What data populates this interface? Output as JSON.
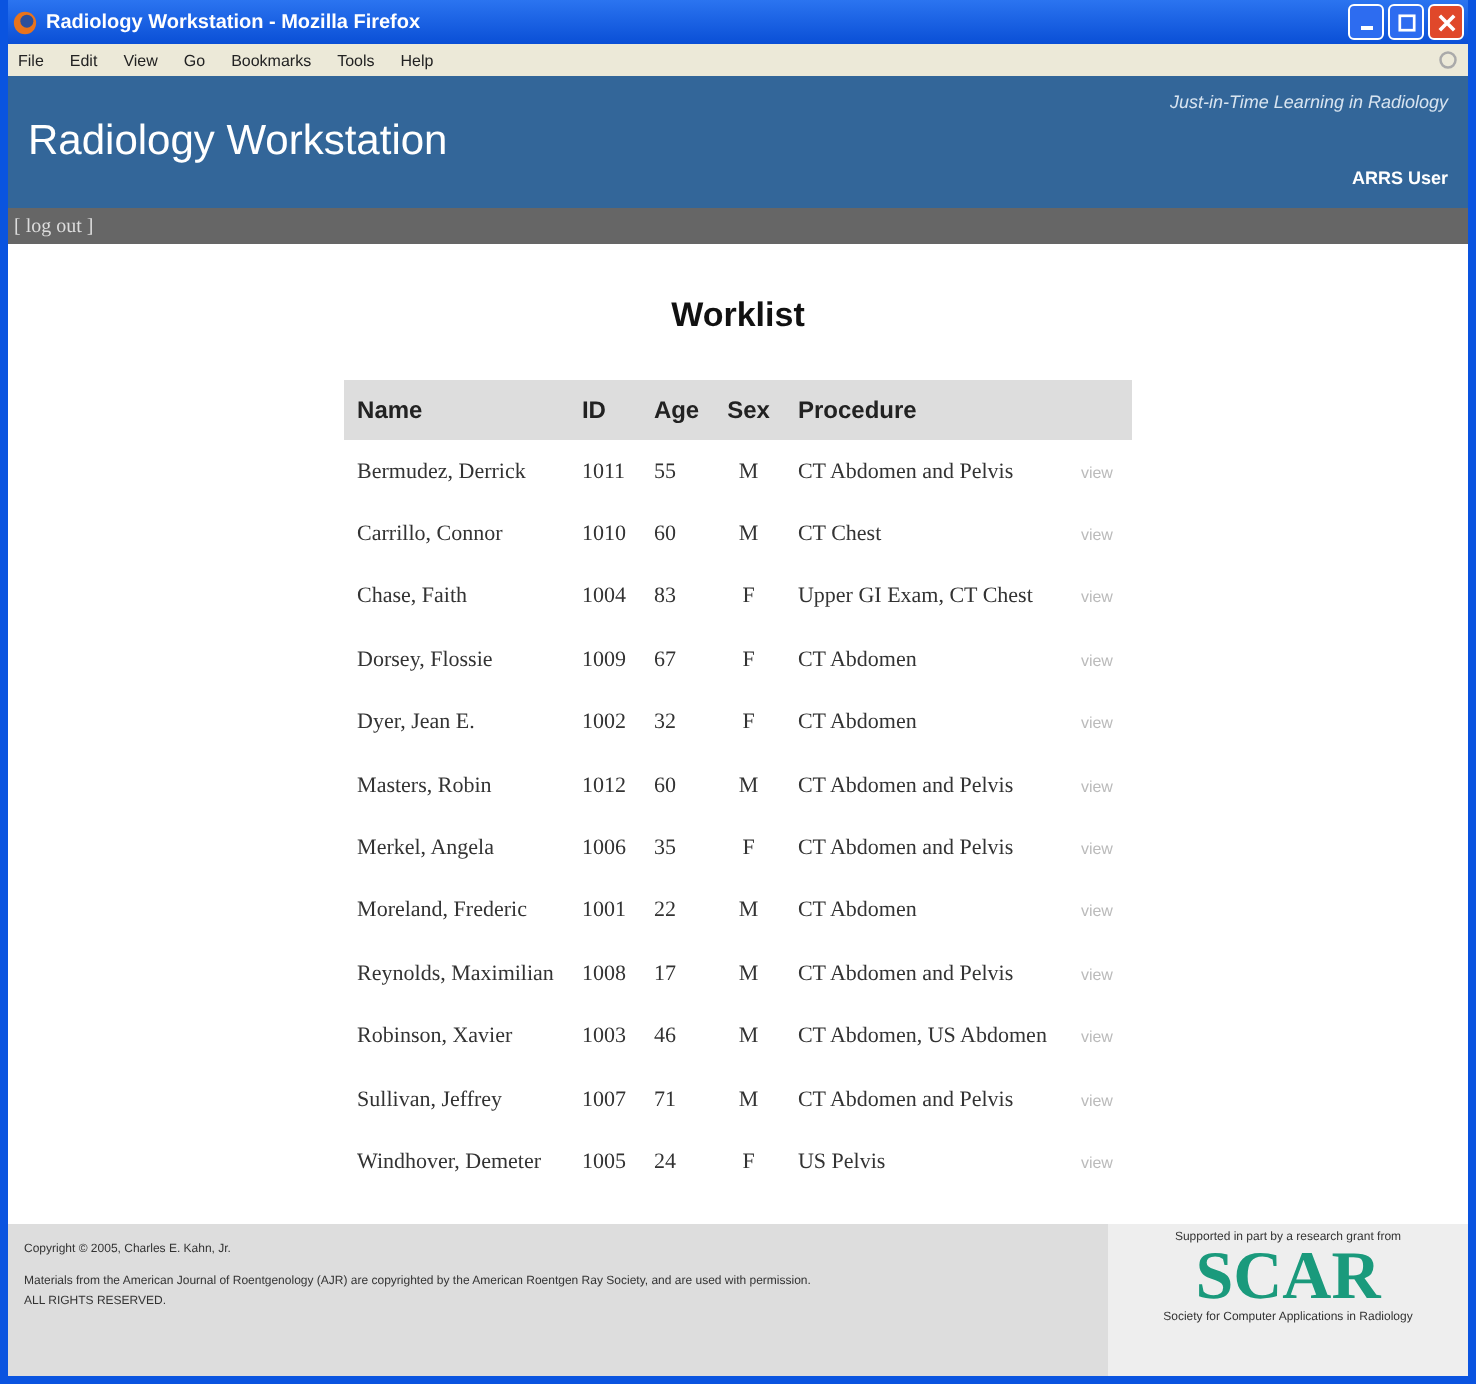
{
  "window": {
    "title": "Radiology Workstation - Mozilla Firefox"
  },
  "menu": [
    "File",
    "Edit",
    "View",
    "Go",
    "Bookmarks",
    "Tools",
    "Help"
  ],
  "header": {
    "title": "Radiology Workstation",
    "tagline": "Just-in-Time Learning in Radiology",
    "user": "ARRS User",
    "logout": "[ log out ]"
  },
  "worklist": {
    "title": "Worklist",
    "columns": [
      "Name",
      "ID",
      "Age",
      "Sex",
      "Procedure"
    ],
    "rows": [
      {
        "name": "Bermudez, Derrick",
        "id": "1011",
        "age": "55",
        "sex": "M",
        "procedure": "CT Abdomen and Pelvis",
        "action": "view"
      },
      {
        "name": "Carrillo, Connor",
        "id": "1010",
        "age": "60",
        "sex": "M",
        "procedure": "CT Chest",
        "action": "view"
      },
      {
        "name": "Chase, Faith",
        "id": "1004",
        "age": "83",
        "sex": "F",
        "procedure": "Upper GI Exam, CT Chest",
        "action": "view"
      },
      {
        "name": "Dorsey, Flossie",
        "id": "1009",
        "age": "67",
        "sex": "F",
        "procedure": "CT Abdomen",
        "action": "view"
      },
      {
        "name": "Dyer, Jean E.",
        "id": "1002",
        "age": "32",
        "sex": "F",
        "procedure": "CT Abdomen",
        "action": "view"
      },
      {
        "name": "Masters, Robin",
        "id": "1012",
        "age": "60",
        "sex": "M",
        "procedure": "CT Abdomen and Pelvis",
        "action": "view"
      },
      {
        "name": "Merkel, Angela",
        "id": "1006",
        "age": "35",
        "sex": "F",
        "procedure": "CT Abdomen and Pelvis",
        "action": "view"
      },
      {
        "name": "Moreland, Frederic",
        "id": "1001",
        "age": "22",
        "sex": "M",
        "procedure": "CT Abdomen",
        "action": "view"
      },
      {
        "name": "Reynolds, Maximilian",
        "id": "1008",
        "age": "17",
        "sex": "M",
        "procedure": "CT Abdomen and Pelvis",
        "action": "view"
      },
      {
        "name": "Robinson, Xavier",
        "id": "1003",
        "age": "46",
        "sex": "M",
        "procedure": "CT Abdomen, US Abdomen",
        "action": "view"
      },
      {
        "name": "Sullivan, Jeffrey",
        "id": "1007",
        "age": "71",
        "sex": "M",
        "procedure": "CT Abdomen and Pelvis",
        "action": "view"
      },
      {
        "name": "Windhover, Demeter",
        "id": "1005",
        "age": "24",
        "sex": "F",
        "procedure": "US Pelvis",
        "action": "view"
      }
    ]
  },
  "footer": {
    "copyright": "Copyright © 2005, Charles E. Kahn, Jr.",
    "notice": "Materials from the American Journal of Roentgenology (AJR) are copyrighted by the American Roentgen Ray Society, and are used with permission.",
    "rights": "ALL RIGHTS RESERVED.",
    "sponsor_note": "Supported in part by a research grant from",
    "sponsor_logo": "SCAR",
    "sponsor_name": "Society for Computer Applications in Radiology"
  }
}
